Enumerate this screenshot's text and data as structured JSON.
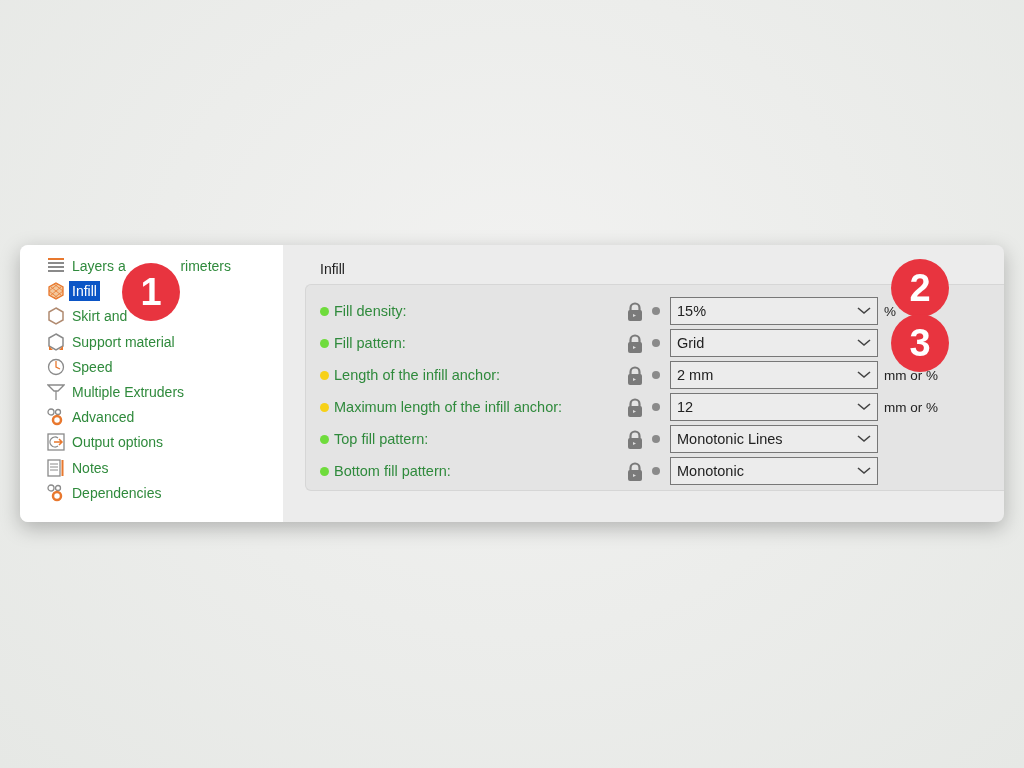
{
  "sidebar": {
    "items": [
      {
        "label": "Layers a",
        "label_cont": "rimeters",
        "selected": false
      },
      {
        "label": "Infill",
        "selected": true
      },
      {
        "label": "Skirt and",
        "selected": false
      },
      {
        "label": "Support material",
        "selected": false
      },
      {
        "label": "Speed",
        "selected": false
      },
      {
        "label": "Multiple Extruders",
        "selected": false
      },
      {
        "label": "Advanced",
        "selected": false
      },
      {
        "label": "Output options",
        "selected": false
      },
      {
        "label": "Notes",
        "selected": false
      },
      {
        "label": "Dependencies",
        "selected": false
      }
    ]
  },
  "page": {
    "title": "Infill",
    "settings": [
      {
        "label": "Fill density:",
        "color": "#6fdc3c",
        "value": "15%",
        "unit": "%"
      },
      {
        "label": "Fill pattern:",
        "color": "#6fdc3c",
        "value": "Grid"
      },
      {
        "label": "Length of the infill anchor:",
        "color": "#f7d117",
        "value": "2 mm",
        "unit": "mm or %"
      },
      {
        "label": "Maximum length of the infill anchor:",
        "color": "#f7d117",
        "value": "12",
        "unit": "mm or %"
      },
      {
        "label": "Top fill pattern:",
        "color": "#6fdc3c",
        "value": "Monotonic Lines"
      },
      {
        "label": "Bottom fill pattern:",
        "color": "#6fdc3c",
        "value": "Monotonic"
      }
    ]
  },
  "callouts": [
    "1",
    "2",
    "3"
  ]
}
